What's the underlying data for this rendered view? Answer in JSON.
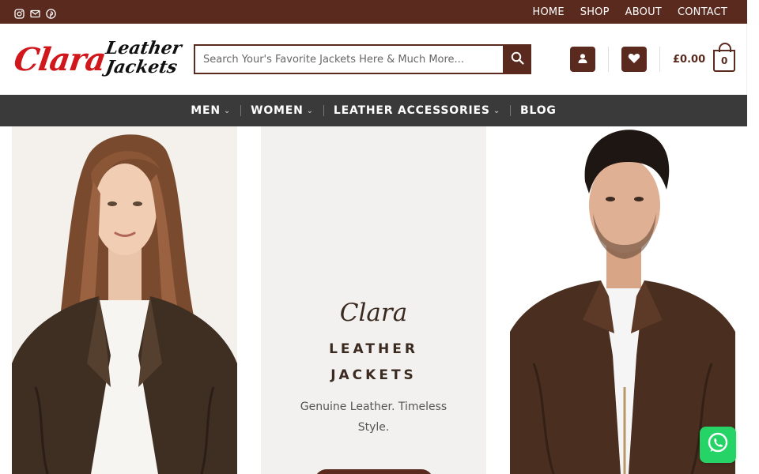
{
  "topbar": {
    "social_icons": [
      "instagram-icon",
      "mail-icon",
      "pinterest-icon"
    ],
    "nav": [
      "HOME",
      "SHOP",
      "ABOUT",
      "CONTACT"
    ]
  },
  "header": {
    "logo": {
      "script": "Clara",
      "word1": "Leather",
      "word2": "Jackets"
    },
    "search": {
      "placeholder": "Search Your's Favorite Jackets Here & Much More...",
      "value": ""
    },
    "account_icon": "user-icon",
    "wishlist_icon": "heart-icon",
    "cart": {
      "amount": "£0.00",
      "count": "0"
    }
  },
  "mainnav": {
    "items": [
      {
        "label": "MEN",
        "has_dropdown": true
      },
      {
        "label": "WOMEN",
        "has_dropdown": true
      },
      {
        "label": "LEATHER ACCESSORIES",
        "has_dropdown": true
      },
      {
        "label": "BLOG",
        "has_dropdown": false
      }
    ]
  },
  "hero": {
    "brand": "Clara",
    "line1": "LEATHER",
    "line2": "JACKETS",
    "tagline": "Genuine Leather. Timeless Style."
  },
  "colors": {
    "brand_brown": "#5a2a1f",
    "nav_dark": "#3a3a3a",
    "logo_red": "#d0181c",
    "whatsapp": "#25d366"
  }
}
